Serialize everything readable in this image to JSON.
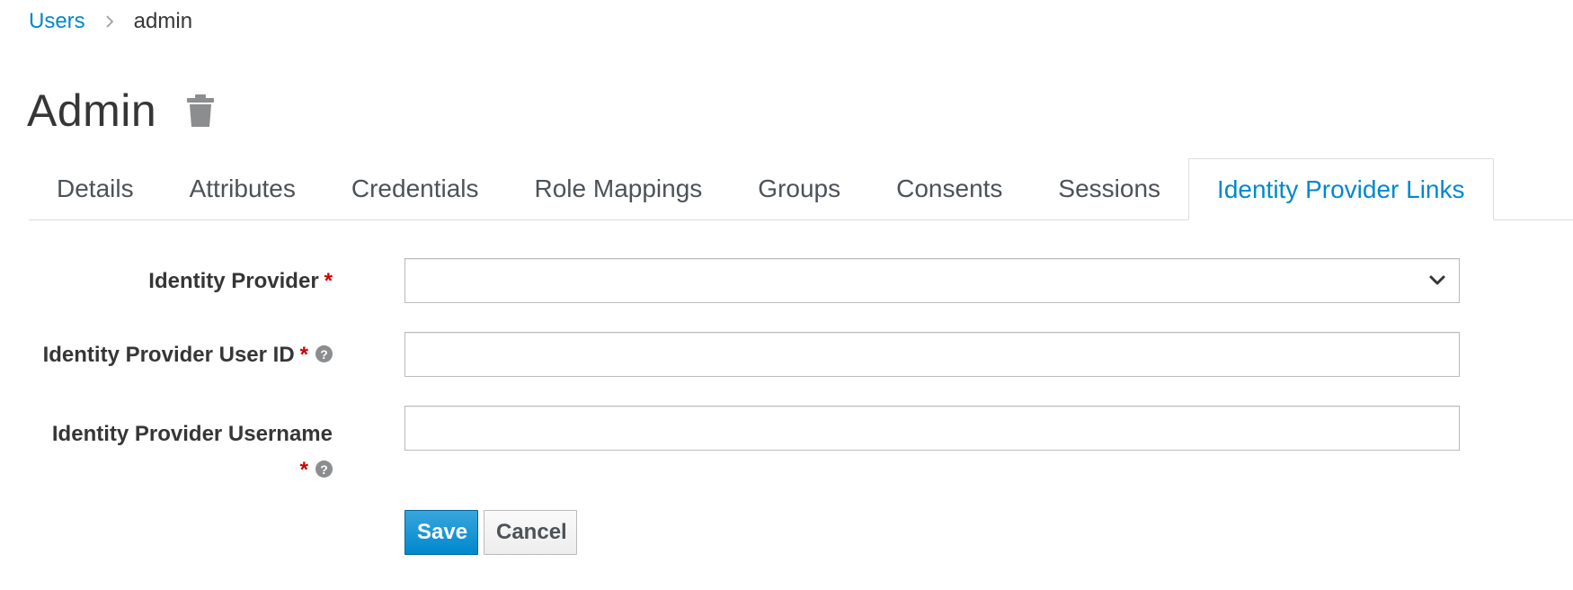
{
  "breadcrumb": {
    "parent_label": "Users",
    "current_label": "admin"
  },
  "header": {
    "title": "Admin",
    "delete_icon": "trash-icon"
  },
  "tabs": [
    {
      "label": "Details",
      "active": false
    },
    {
      "label": "Attributes",
      "active": false
    },
    {
      "label": "Credentials",
      "active": false
    },
    {
      "label": "Role Mappings",
      "active": false
    },
    {
      "label": "Groups",
      "active": false
    },
    {
      "label": "Consents",
      "active": false
    },
    {
      "label": "Sessions",
      "active": false
    },
    {
      "label": "Identity Provider Links",
      "active": true
    }
  ],
  "form": {
    "identity_provider": {
      "label": "Identity Provider",
      "required_marker": "*",
      "value": ""
    },
    "identity_provider_user_id": {
      "label": "Identity Provider User ID",
      "required_marker": "*",
      "help_icon": "help-icon",
      "value": ""
    },
    "identity_provider_username": {
      "label": "Identity Provider Username",
      "required_marker": "*",
      "help_icon": "help-icon",
      "value": ""
    }
  },
  "actions": {
    "save_label": "Save",
    "cancel_label": "Cancel"
  },
  "colors": {
    "link": "#0088ce",
    "required": "#cc0000",
    "primary_button": "#0088ce"
  }
}
